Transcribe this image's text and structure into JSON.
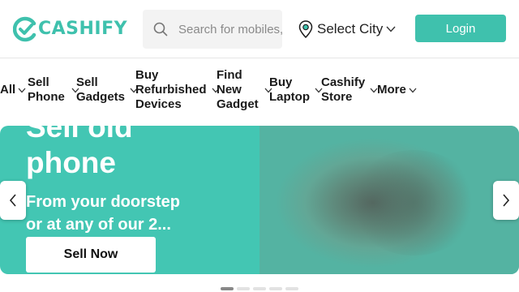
{
  "brand": {
    "name": "CASHIFY",
    "color": "#3fc1ad",
    "logo_icon": "cashify-check-icon"
  },
  "search": {
    "placeholder": "Search for mobiles, accessories & more",
    "icon": "search-icon"
  },
  "city": {
    "label": "Select City",
    "icon": "location-pin-icon"
  },
  "login": {
    "label": "Login"
  },
  "nav": [
    {
      "label": "All"
    },
    {
      "label": "Sell\nPhone"
    },
    {
      "label": "Sell\nGadgets"
    },
    {
      "label": "Buy\nRefurbished\nDevices"
    },
    {
      "label": "Find\nNew\nGadget"
    },
    {
      "label": "Buy\nLaptop"
    },
    {
      "label": "Cashify\nStore"
    },
    {
      "label": "More"
    }
  ],
  "hero": {
    "title": "Sell old\nphone",
    "subtitle": "From your doorstep\nor at any of our 2...",
    "cta": "Sell Now",
    "background": "#43c6b3"
  },
  "carousel": {
    "slides": 5,
    "active": 1
  }
}
